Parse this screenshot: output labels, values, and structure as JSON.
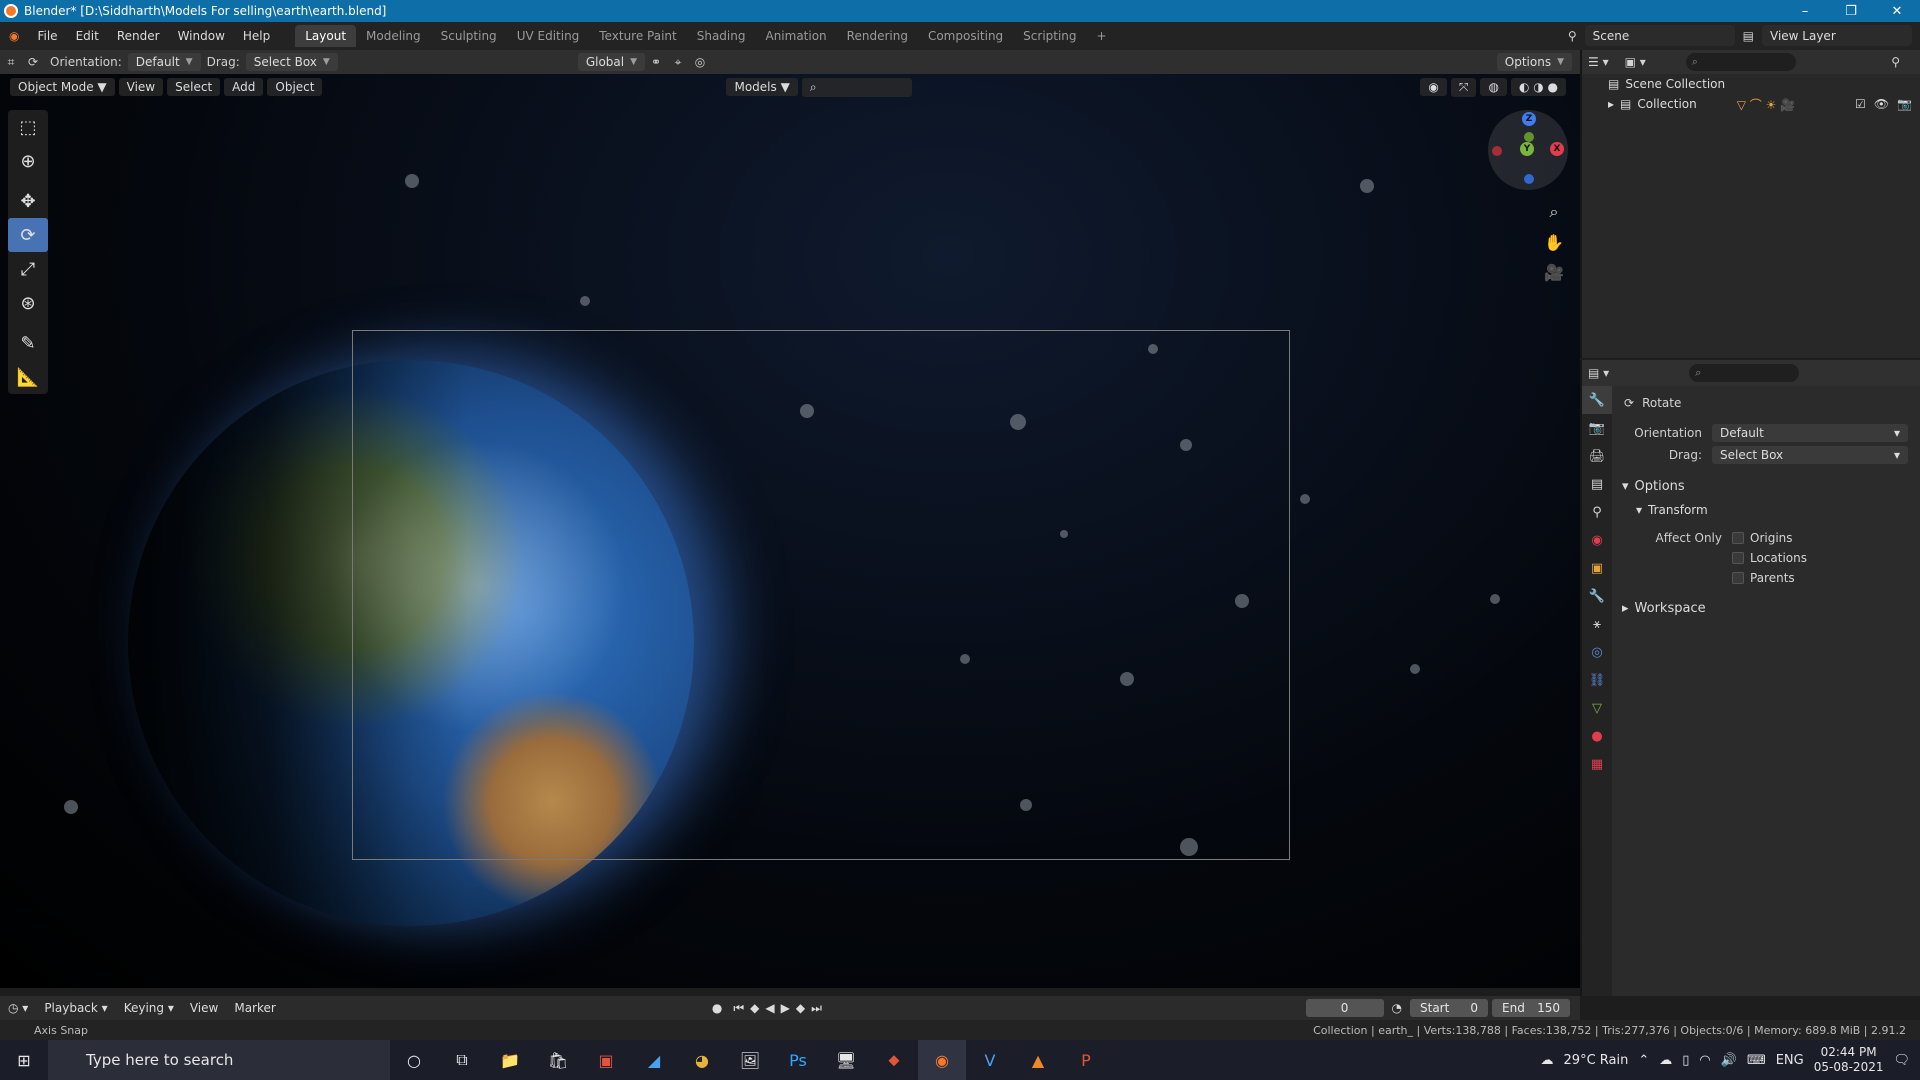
{
  "window": {
    "title": "Blender* [D:\\Siddharth\\Models For selling\\earth\\earth.blend]",
    "minimize": "–",
    "maximize": "❐",
    "close": "✕"
  },
  "menubar": {
    "items": [
      "File",
      "Edit",
      "Render",
      "Window",
      "Help"
    ],
    "workspaces": [
      "Layout",
      "Modeling",
      "Sculpting",
      "UV Editing",
      "Texture Paint",
      "Shading",
      "Animation",
      "Rendering",
      "Compositing",
      "Scripting"
    ],
    "add_tab": "+",
    "scene": "Scene",
    "view_layer": "View Layer"
  },
  "tool_header": {
    "orientation_label": "Orientation:",
    "orientation_value": "Default",
    "drag_label": "Drag:",
    "drag_value": "Select Box",
    "transform_orientation": "Global",
    "options_label": "Options"
  },
  "viewport_header": {
    "mode": "Object Mode",
    "menus": [
      "View",
      "Select",
      "Add",
      "Object"
    ],
    "collection_filter": "Models"
  },
  "timeline": {
    "menus": [
      "Playback",
      "Keying",
      "View",
      "Marker"
    ],
    "current_frame": "0",
    "start_label": "Start",
    "start_value": "0",
    "end_label": "End",
    "end_value": "150"
  },
  "statusbar": {
    "left": "Axis Snap",
    "right": "Collection | earth_ | Verts:138,788 | Faces:138,752 | Tris:277,376 | Objects:0/6 | Memory: 689.8 MiB | 2.91.2"
  },
  "outliner": {
    "scene_collection": "Scene Collection",
    "collection": "Collection"
  },
  "properties": {
    "tool_name": "Rotate",
    "orientation_label": "Orientation",
    "orientation_value": "Default",
    "drag_label": "Drag:",
    "drag_value": "Select Box",
    "options_panel": "Options",
    "transform_panel": "Transform",
    "affect_only_label": "Affect Only",
    "affect_items": [
      "Origins",
      "Locations",
      "Parents"
    ],
    "workspace_panel": "Workspace"
  },
  "gizmo": {
    "z": "Z",
    "y": "Y",
    "x": "X"
  },
  "taskbar": {
    "search_placeholder": "Type here to search",
    "weather": "29°C  Rain",
    "language": "ENG",
    "time": "02:44 PM",
    "date": "05-08-2021"
  }
}
